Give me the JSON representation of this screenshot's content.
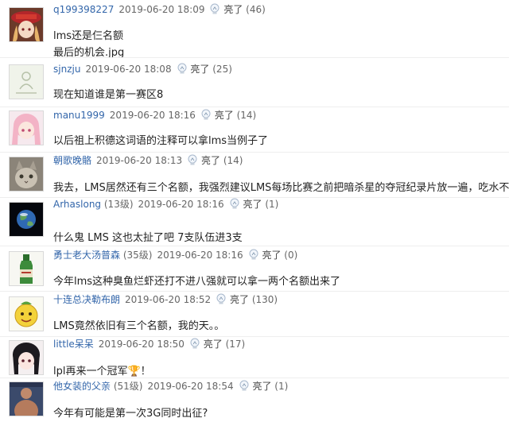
{
  "comments": [
    {
      "user": "q199398227",
      "level": "",
      "date": "2019-06-20 18:09",
      "like_label": "亮了",
      "like_count": "(46)",
      "lines": [
        "lms还是仨名额",
        "最后的机会.jpg"
      ],
      "avatar": "avatar-anime-red-hat-icon"
    },
    {
      "user": "sjnzju",
      "level": "",
      "date": "2019-06-20 18:08",
      "like_label": "亮了",
      "like_count": "(25)",
      "lines": [
        "现在知道谁是第一赛区8"
      ],
      "avatar": "avatar-placeholder-icon"
    },
    {
      "user": "manu1999",
      "level": "",
      "date": "2019-06-20 18:16",
      "like_label": "亮了",
      "like_count": "(14)",
      "lines": [
        "以后祖上积德这词语的注释可以拿lms当例子了"
      ],
      "avatar": "avatar-anime-pink-hair-icon"
    },
    {
      "user": "朝歌晚骼",
      "level": "",
      "date": "2019-06-20 18:13",
      "like_label": "亮了",
      "like_count": "(14)",
      "lines": [
        "我去，LMS居然还有三个名额，我强烈建议LMS每场比赛之前把暗杀星的夺冠纪录片放一遍，吃水不忘挖井人"
      ],
      "avatar": "avatar-cat-icon"
    },
    {
      "user": "Arhaslong",
      "level": "(13级)",
      "date": "2019-06-20 18:16",
      "like_label": "亮了",
      "like_count": "(1)",
      "lines": [
        "什么鬼 LMS 这也太扯了吧 7支队伍进3支"
      ],
      "avatar": "avatar-earth-icon"
    },
    {
      "user": "勇士老大汤普森",
      "level": "(35级)",
      "date": "2019-06-20 18:16",
      "like_label": "亮了",
      "like_count": "(0)",
      "lines": [
        "今年lms这种臭鱼烂虾还打不进八强就可以拿一两个名额出来了"
      ],
      "avatar": "avatar-bottle-icon"
    },
    {
      "user": "十连总决勒布朗",
      "level": "",
      "date": "2019-06-20 18:52",
      "like_label": "亮了",
      "like_count": "(130)",
      "lines": [
        "LMS竟然依旧有三个名额，我的天。。"
      ],
      "avatar": "avatar-cartoon-lemon-icon"
    },
    {
      "user": "little呆呆",
      "level": "",
      "date": "2019-06-20 18:50",
      "like_label": "亮了",
      "like_count": "(17)",
      "lines": [
        "lpl再来一个冠军🏆！"
      ],
      "avatar": "avatar-anime-girl-icon"
    },
    {
      "user": "他女装的父亲",
      "level": "(51级)",
      "date": "2019-06-20 18:54",
      "like_label": "亮了",
      "like_count": "(1)",
      "lines": [
        "今年有可能是第一次3G同时出征?"
      ],
      "avatar": "avatar-man-photo-icon"
    }
  ]
}
